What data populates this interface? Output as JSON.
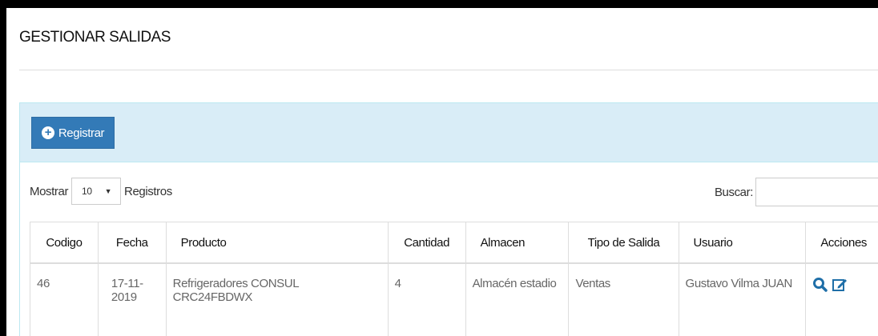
{
  "page": {
    "title": "GESTIONAR SALIDAS"
  },
  "toolbar": {
    "register_label": "Registrar"
  },
  "length": {
    "prefix": "Mostrar",
    "value": "10",
    "suffix": "Registros"
  },
  "search": {
    "label": "Buscar:",
    "value": ""
  },
  "table": {
    "headers": [
      "Codigo",
      "Fecha",
      "Producto",
      "Cantidad",
      "Almacen",
      "Tipo de Salida",
      "Usuario",
      "Acciones"
    ],
    "rows": [
      {
        "codigo": "46",
        "fecha": "17-11-2019",
        "producto": "Refrigeradores CONSUL CRC24FBDWX",
        "cantidad": "4",
        "almacen": "Almacén estadio",
        "tipo": "Ventas",
        "usuario": "Gustavo Vilma JUAN"
      }
    ]
  },
  "colors": {
    "primary": "#337ab7",
    "panel_heading": "#d9edf7",
    "panel_border": "#bce8f1",
    "icon": "#1f6fa8"
  },
  "icons": [
    "plus-circle-icon",
    "caret-down-icon",
    "search-icon",
    "edit-icon"
  ]
}
